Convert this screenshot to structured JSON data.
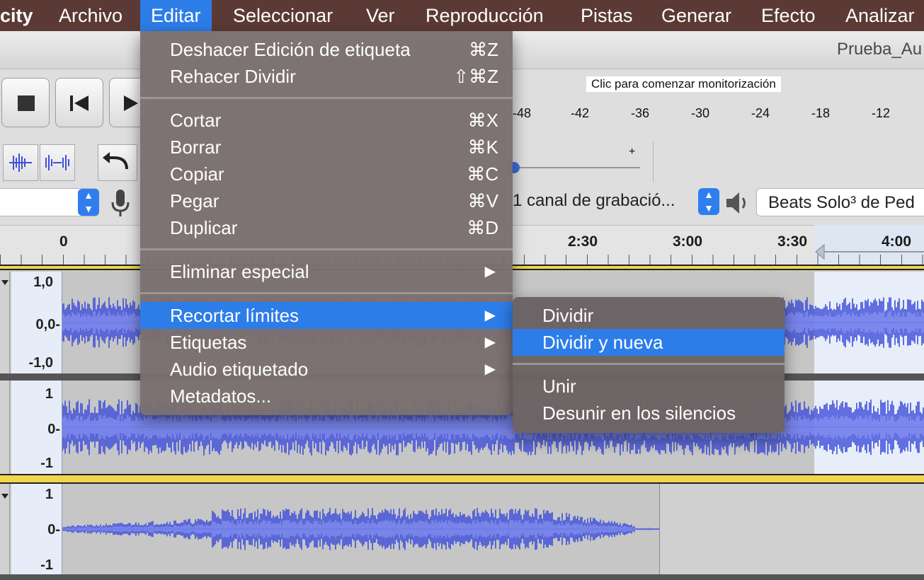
{
  "menubar": {
    "items": [
      "city",
      "Archivo",
      "Editar",
      "Seleccionar",
      "Ver",
      "Reproducción",
      "Pistas",
      "Generar",
      "Efecto",
      "Analizar"
    ],
    "active": "Editar"
  },
  "window": {
    "title": "Prueba_Au"
  },
  "meter": {
    "hint": "Clic para comenzar monitorización",
    "ticks": [
      "-48",
      "-42",
      "-36",
      "-30",
      "-24",
      "-18",
      "-12"
    ],
    "plus": "+"
  },
  "devices": {
    "channels": "1 canal de grabació...",
    "output": "Beats Solo³ de Ped"
  },
  "ruler": {
    "labels": [
      "0",
      "2:30",
      "3:00",
      "3:30",
      "4:00"
    ]
  },
  "tracks": [
    {
      "scale": [
        "1,0",
        "0,0-",
        "-1,0"
      ]
    },
    {
      "scale": [
        "1",
        "0-",
        "-1"
      ]
    },
    {
      "scale": [
        "1",
        "0-",
        "-1"
      ]
    }
  ],
  "edit_menu": {
    "groups": [
      [
        {
          "label": "Deshacer Edición de etiqueta",
          "shortcut": "⌘Z"
        },
        {
          "label": "Rehacer Dividir",
          "shortcut": "⇧⌘Z"
        }
      ],
      [
        {
          "label": "Cortar",
          "shortcut": "⌘X"
        },
        {
          "label": "Borrar",
          "shortcut": "⌘K"
        },
        {
          "label": "Copiar",
          "shortcut": "⌘C"
        },
        {
          "label": "Pegar",
          "shortcut": "⌘V"
        },
        {
          "label": "Duplicar",
          "shortcut": "⌘D"
        }
      ],
      [
        {
          "label": "Eliminar especial",
          "submenu": "▶"
        }
      ],
      [
        {
          "label": "Recortar límites",
          "submenu": "▶",
          "highlighted": true
        },
        {
          "label": "Etiquetas",
          "submenu": "▶"
        },
        {
          "label": "Audio etiquetado",
          "submenu": "▶"
        },
        {
          "label": "Metadatos..."
        }
      ]
    ]
  },
  "submenu": {
    "items": [
      "Dividir",
      "Dividir y nueva",
      "Unir",
      "Desunir en los silencios"
    ],
    "highlighted": "Dividir y nueva"
  },
  "colors": {
    "menubar": "#5b3a35",
    "highlight": "#2d7de8",
    "waveform": "#3f4fd9",
    "waveform_rms": "#7a86ee"
  }
}
